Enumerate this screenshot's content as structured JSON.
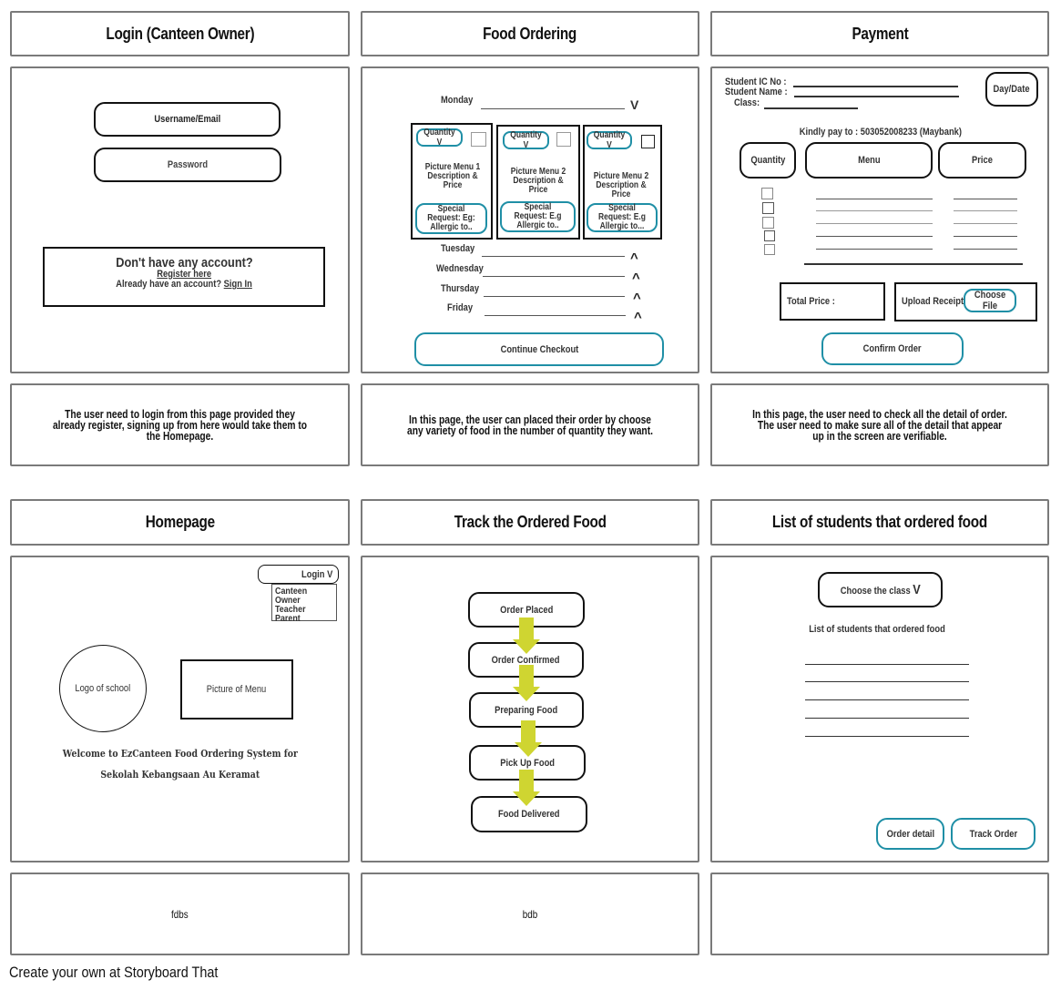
{
  "storyboard": {
    "titles": [
      "Login (Canteen Owner)",
      "Food  Ordering",
      "Payment",
      "Homepage",
      "Track the Ordered  Food",
      "List of students that ordered food"
    ],
    "descriptions": [
      "The user need to login from this page provided they already register, signing up from here would take them to the Homepage.",
      "In this page,  the user can placed their order by choose any variety of food in the number of quantity they want.",
      "In this page, the user need to check all the detail of order. The user need to make sure all of the detail that appear up in the screen are verifiable.",
      "fdbs",
      "bdb",
      ""
    ],
    "footer": "Create your own at Storyboard That"
  },
  "colors": {
    "accent_teal": "#1f8fa6",
    "arrow_yellow": "#cfd531",
    "border_gray": "#7a7a7a"
  },
  "login": {
    "username_placeholder": "Username/Email",
    "password_placeholder": "Password",
    "no_account": "Don't have any account?",
    "register_link": "Register here",
    "already_have": "Already have an account?",
    "sign_in_link": "Sign In"
  },
  "ordering": {
    "days": [
      "Monday",
      "Tuesday",
      "Wednesday",
      "Thursday",
      "Friday"
    ],
    "monday_chevron": "V",
    "collapsed_chevron": "^",
    "menu_cards": [
      {
        "quantity_label": "Quantity V",
        "description": "Picture Menu 1 Description & Price",
        "special_request": "Special Request: Eg: Allergic to.."
      },
      {
        "quantity_label": "Quantity V",
        "description": "Picture Menu 2 Description & Price",
        "special_request": "Special Request: E.g Allergic to.."
      },
      {
        "quantity_label": "Quantity V",
        "description": "Picture Menu 2 Description & Price",
        "special_request": "Special Request: E.g Allergic to..."
      }
    ],
    "continue_button": "Continue Checkout"
  },
  "payment": {
    "ic_label": "Student IC No :",
    "name_label": "Student Name :",
    "class_label": "Class:",
    "day_date": "Day/Date",
    "pay_to": "Kindly pay to : 503052008233 (Maybank)",
    "col_quantity": "Quantity",
    "col_menu": "Menu",
    "col_price": "Price",
    "total_price_label": "Total Price :",
    "upload_label": "Upload Receipt:",
    "choose_file": "Choose File",
    "confirm_button": "Confirm Order"
  },
  "homepage": {
    "login_dropdown": "Login  V",
    "login_options": [
      "Canteen Owner",
      "Teacher",
      "Parent"
    ],
    "logo_label": "Logo of school",
    "menu_picture_label": "Picture of Menu",
    "welcome_line1": "Welcome to EzCanteen Food Ordering System for",
    "welcome_line2": "Sekolah Kebangsaan Au Keramat"
  },
  "tracking": {
    "steps": [
      "Order Placed",
      "Order Confirmed",
      "Preparing Food",
      "Pick Up Food",
      "Food Delivered"
    ]
  },
  "student_list": {
    "class_dropdown": "Choose the  class",
    "class_chevron": "V",
    "list_heading": "List of students that ordered food",
    "order_detail_button": "Order detail",
    "track_order_button": "Track Order"
  }
}
